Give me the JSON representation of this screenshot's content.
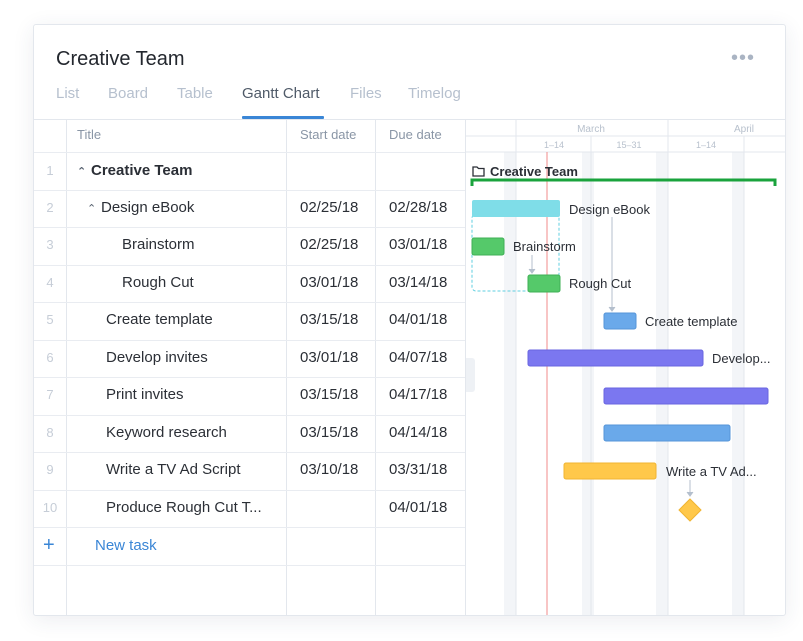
{
  "project_title": "Creative Team",
  "more_icon": "ellipsis-icon",
  "tabs": [
    {
      "label": "List",
      "active": false
    },
    {
      "label": "Board",
      "active": false
    },
    {
      "label": "Table",
      "active": false
    },
    {
      "label": "Gantt Chart",
      "active": true
    },
    {
      "label": "Files",
      "active": false
    },
    {
      "label": "Timelog",
      "active": false
    }
  ],
  "columns": {
    "title": "Title",
    "start": "Start date",
    "due": "Due date"
  },
  "rows": [
    {
      "num": "1",
      "title": "Creative Team",
      "start": "",
      "due": ""
    },
    {
      "num": "2",
      "title": "Design eBook",
      "start": "02/25/18",
      "due": "02/28/18"
    },
    {
      "num": "3",
      "title": "Brainstorm",
      "start": "02/25/18",
      "due": "03/01/18"
    },
    {
      "num": "4",
      "title": "Rough Cut",
      "start": "03/01/18",
      "due": "03/14/18"
    },
    {
      "num": "5",
      "title": "Create template",
      "start": "03/15/18",
      "due": "04/01/18"
    },
    {
      "num": "6",
      "title": "Develop invites",
      "start": "03/01/18",
      "due": "04/07/18"
    },
    {
      "num": "7",
      "title": "Print invites",
      "start": "03/15/18",
      "due": "04/17/18"
    },
    {
      "num": "8",
      "title": "Keyword research",
      "start": "03/15/18",
      "due": "04/14/18"
    },
    {
      "num": "9",
      "title": "Write a TV Ad Script",
      "start": "03/10/18",
      "due": "03/31/18"
    },
    {
      "num": "10",
      "title": "Produce Rough Cut T...",
      "start": "",
      "due": "04/01/18"
    }
  ],
  "new_task_label": "New task",
  "gantt": {
    "months": [
      "March",
      "April"
    ],
    "ranges": [
      "1–14",
      "15–31",
      "1–14"
    ],
    "project_label": "Creative Team",
    "labels": {
      "design_ebook": "Design eBook",
      "brainstorm": "Brainstorm",
      "rough_cut": "Rough Cut",
      "create_template": "Create template",
      "develop_invites": "Develop...",
      "write_tv_ad": "Write a TV Ad..."
    },
    "colors": {
      "project": "#1aa33c",
      "design_ebook": "#7fdde8",
      "green": "#55c96a",
      "blue": "#6aa9ea",
      "purple": "#7b77f0",
      "yellow": "#ffc84a",
      "today_line": "#f08b8b",
      "accent": "#3a86d6"
    }
  }
}
